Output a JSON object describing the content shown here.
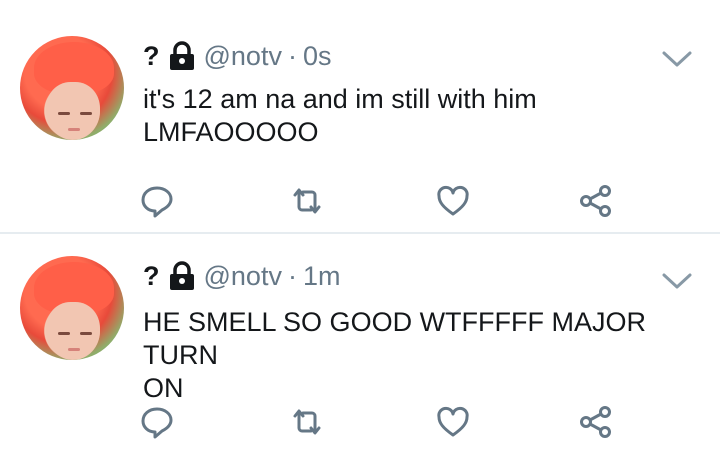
{
  "tweets": [
    {
      "display_name": "?",
      "handle": "@notv",
      "separator": "·",
      "time": "0s",
      "text_lines": [
        "it's 12 am na and im still with him",
        "LMFAOOOOO"
      ],
      "icons": {
        "avatar": "avatar",
        "lock": "lock-icon",
        "menu": "chevron-down-icon",
        "reply": "reply-icon",
        "retweet": "retweet-icon",
        "like": "heart-icon",
        "share": "share-icon"
      }
    },
    {
      "display_name": "?",
      "handle": "@notv",
      "separator": "·",
      "time": "1m",
      "text_lines": [
        "HE SMELL SO GOOD WTFFFFF MAJOR TURN",
        "ON"
      ],
      "icons": {
        "avatar": "avatar",
        "lock": "lock-icon",
        "menu": "chevron-down-icon",
        "reply": "reply-icon",
        "retweet": "retweet-icon",
        "like": "heart-icon",
        "share": "share-icon"
      }
    }
  ],
  "colors": {
    "text": "#14171a",
    "secondary": "#657786",
    "icon": "#657786",
    "divider": "#e6ecf0"
  }
}
